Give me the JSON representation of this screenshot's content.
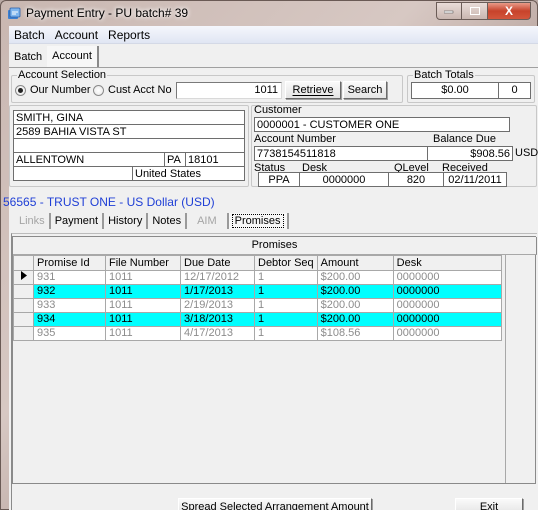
{
  "window": {
    "title": "Payment Entry - PU batch# 39",
    "controls": {
      "minimize": "–",
      "maximize": "□",
      "close": "X"
    }
  },
  "menu": [
    "Batch",
    "Account",
    "Reports"
  ],
  "top_tabs": [
    {
      "label": "Batch",
      "active": false
    },
    {
      "label": "Account",
      "active": true
    }
  ],
  "account_selection": {
    "group_label": "Account Selection",
    "options": [
      {
        "label": "Our Number",
        "selected": true
      },
      {
        "label": "Cust Acct No",
        "selected": false
      }
    ],
    "input_value": "1011",
    "retrieve_label": "Retrieve",
    "search_label": "Search"
  },
  "batch_totals": {
    "group_label": "Batch Totals",
    "amount": "$0.00",
    "count": "0"
  },
  "address": {
    "name": "SMITH, GINA",
    "street": "2589 BAHIA VISTA ST",
    "street2": "",
    "city": "ALLENTOWN",
    "state": "PA",
    "zip": "18101",
    "blank": "",
    "country": "United States"
  },
  "account_info": {
    "customer_label": "Customer",
    "customer": "0000001 - CUSTOMER ONE",
    "account_number_label": "Account Number",
    "account_number": "7738154511818",
    "balance_due_label": "Balance Due",
    "balance_due": "$908.56",
    "currency": "USD",
    "status_label": "Status",
    "status": "PPA",
    "desk_label": "Desk",
    "desk": "0000000",
    "qlevel_label": "QLevel",
    "qlevel": "820",
    "received_label": "Received",
    "received": "02/11/2011"
  },
  "trust_line": "56565 - TRUST ONE - US Dollar (USD)",
  "sub_tabs": [
    {
      "label": "Links",
      "disabled": true
    },
    {
      "label": "Payment",
      "disabled": false
    },
    {
      "label": "History",
      "disabled": false
    },
    {
      "label": "Notes",
      "disabled": false
    },
    {
      "label": "AIM",
      "disabled": true
    },
    {
      "label": "Promises",
      "disabled": false,
      "active": true
    }
  ],
  "promises": {
    "caption": "Promises",
    "columns": [
      "Promise Id",
      "File Number",
      "Due Date",
      "Debtor Seq",
      "Amount",
      "Desk"
    ],
    "rows": [
      {
        "current": true,
        "highlight": false,
        "cells": [
          "931",
          "1011",
          "12/17/2012",
          "1",
          "$200.00",
          "0000000"
        ]
      },
      {
        "current": false,
        "highlight": true,
        "cells": [
          "932",
          "1011",
          "1/17/2013",
          "1",
          "$200.00",
          "0000000"
        ]
      },
      {
        "current": false,
        "highlight": false,
        "cells": [
          "933",
          "1011",
          "2/19/2013",
          "1",
          "$200.00",
          "0000000"
        ]
      },
      {
        "current": false,
        "highlight": true,
        "cells": [
          "934",
          "1011",
          "3/18/2013",
          "1",
          "$200.00",
          "0000000"
        ]
      },
      {
        "current": false,
        "highlight": false,
        "cells": [
          "935",
          "1011",
          "4/17/2013",
          "1",
          "$108.56",
          "0000000"
        ]
      }
    ],
    "highlight_color": "#00ffff"
  },
  "footer": {
    "spread_label": "Spread Selected Arrangement Amount",
    "exit_label": "Exit"
  }
}
